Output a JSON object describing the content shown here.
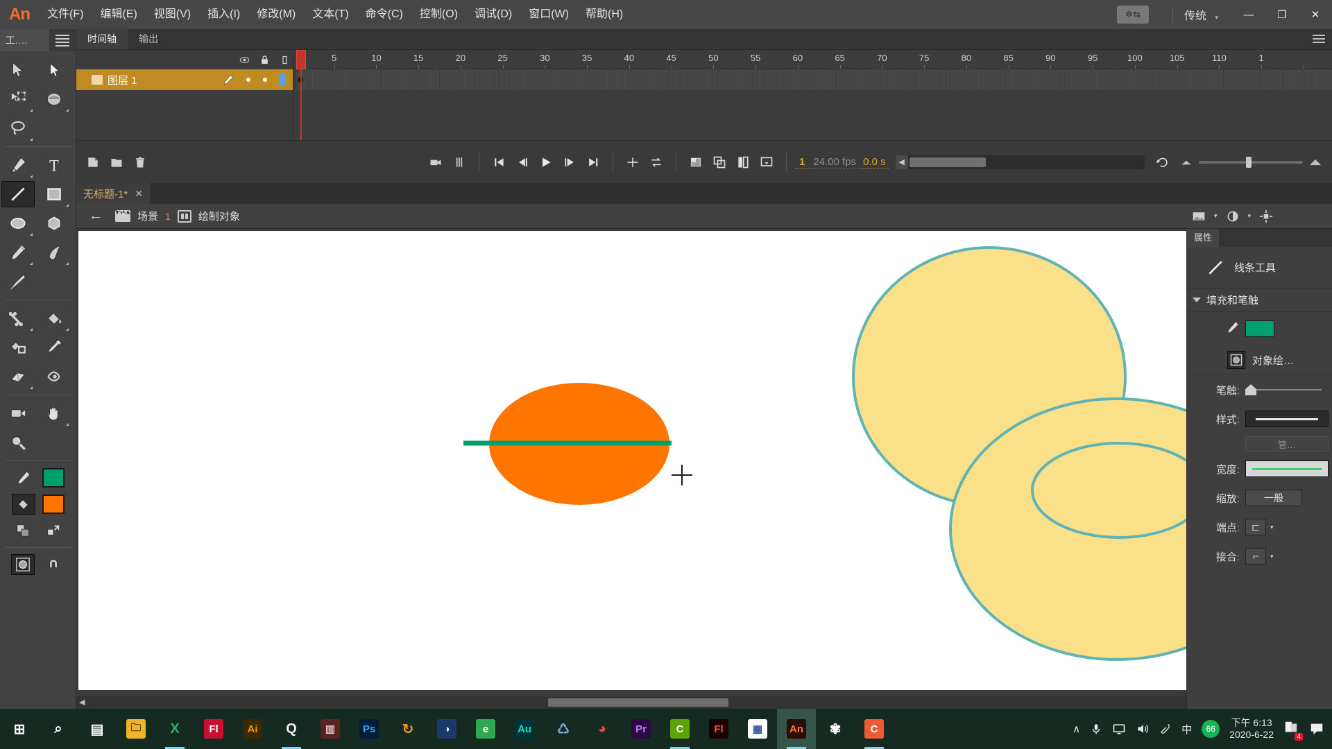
{
  "app": {
    "logo": "An",
    "workspace": "传统"
  },
  "menu": {
    "items": [
      "文件(F)",
      "编辑(E)",
      "视图(V)",
      "插入(I)",
      "修改(M)",
      "文本(T)",
      "命令(C)",
      "控制(O)",
      "调试(D)",
      "窗口(W)",
      "帮助(H)"
    ],
    "window_buttons": {
      "minimize": "—",
      "maximize": "❐",
      "close": "✕"
    },
    "sync_icon": "gear-sync-icon",
    "caret": "▾"
  },
  "toolbar": {
    "title": "工.…",
    "tools": [
      {
        "name": "selection-tool",
        "sel": false
      },
      {
        "name": "subselection-tool",
        "sel": false
      },
      {
        "name": "free-transform-tool",
        "sel": false
      },
      {
        "name": "gradient-transform-tool",
        "sel": false
      },
      {
        "name": "lasso-tool",
        "sel": false
      },
      {
        "name": "pen-tool",
        "sel": false
      },
      {
        "name": "text-tool",
        "sel": false
      },
      {
        "name": "line-tool",
        "sel": true
      },
      {
        "name": "rectangle-tool",
        "sel": false
      },
      {
        "name": "oval-tool",
        "sel": false
      },
      {
        "name": "polystar-tool",
        "sel": false
      },
      {
        "name": "pencil-tool",
        "sel": false
      },
      {
        "name": "brush-tool",
        "sel": false
      },
      {
        "name": "paint-brush-tool",
        "sel": false
      },
      {
        "name": "bone-tool",
        "sel": false
      },
      {
        "name": "paint-bucket-tool",
        "sel": false
      },
      {
        "name": "ink-bottle-tool",
        "sel": false
      },
      {
        "name": "eyedropper-tool",
        "sel": false
      },
      {
        "name": "eraser-tool",
        "sel": false
      },
      {
        "name": "width-tool",
        "sel": false
      },
      {
        "name": "camera-tool",
        "sel": false
      },
      {
        "name": "hand-tool",
        "sel": false
      },
      {
        "name": "zoom-tool",
        "sel": false
      }
    ],
    "stroke_color": "#00A06E",
    "fill_color": "#FF7500",
    "object_drawing_on": true
  },
  "timeline": {
    "tabs": [
      {
        "label": "时间轴",
        "active": true
      },
      {
        "label": "输出",
        "active": false
      }
    ],
    "ruler_labels": [
      "1",
      "5",
      "10",
      "15",
      "20",
      "25",
      "30",
      "35",
      "40",
      "45",
      "50",
      "55",
      "60",
      "65",
      "70",
      "75",
      "80",
      "85",
      "90",
      "95",
      "100",
      "105",
      "110",
      "1"
    ],
    "layers": [
      {
        "name": "图层 1",
        "selected": true
      }
    ],
    "header_icons": [
      "eye-icon",
      "lock-icon",
      "outline-icon"
    ],
    "footer": {
      "new_layer": "new-layer-icon",
      "new_folder": "new-folder-icon",
      "delete": "trash-icon",
      "camera": "camera-icon",
      "onion": "onion-skin-icon",
      "go_start": "go-to-start-icon",
      "step_back": "step-back-icon",
      "play": "play-icon",
      "step_fwd": "step-forward-icon",
      "go_end": "go-to-end-icon",
      "center": "center-frame-icon",
      "loop": "loop-icon",
      "onion1": "onion-skin-outline-icon",
      "onion2": "edit-multiple-frames-icon",
      "onion3": "modify-markers-icon",
      "onion4": "marker-menu-icon",
      "current_frame": "1",
      "fps": "24.00 fps",
      "elapsed": "0.0 s"
    },
    "playhead_frame": 1
  },
  "document": {
    "tab_title": "无标题-1*",
    "close_glyph": "✕"
  },
  "scene_bar": {
    "back": "←",
    "scene_label": "场景",
    "scene_number": "1",
    "object_label": "绘制对象"
  },
  "properties": {
    "tab": "属性",
    "tool_name": "线条工具",
    "section_title": "填充和笔触",
    "stroke_swatch": "#00A06E",
    "object_drawing_label": "对象绘…",
    "rows": [
      {
        "label": "笔触",
        "colon": ":",
        "type": "slider"
      },
      {
        "label": "样式",
        "colon": ":",
        "type": "style"
      },
      {
        "label": "",
        "colon": "",
        "type": "ghost",
        "value": "管…"
      },
      {
        "label": "宽度",
        "colon": ":",
        "type": "width"
      },
      {
        "label": "缩放",
        "colon": ":",
        "type": "select",
        "value": "一般"
      },
      {
        "label": "端点",
        "colon": ":",
        "type": "cap"
      },
      {
        "label": "接合",
        "colon": ":",
        "type": "join"
      }
    ]
  },
  "stage": {
    "shapes": [
      {
        "name": "orange-ellipse",
        "fill": "#FF7500",
        "stroke": "none"
      },
      {
        "name": "green-line",
        "stroke": "#00A06E"
      },
      {
        "name": "yellow-circle-top",
        "fill": "#FBE08A",
        "stroke": "#5FB3B3"
      },
      {
        "name": "yellow-ellipse-bottom",
        "fill": "#FBE08A",
        "stroke": "#5FB3B3"
      },
      {
        "name": "inner-ellipse-ring",
        "fill": "none",
        "stroke": "#5FB3B3"
      }
    ],
    "cursor": "crosshair-cursor"
  },
  "taskbar": {
    "items": [
      {
        "name": "start-button",
        "glyph": "⊞",
        "bg": "transparent",
        "fg": "#ffffff"
      },
      {
        "name": "search-icon",
        "glyph": "⌕",
        "bg": "transparent",
        "fg": "#ffffff"
      },
      {
        "name": "task-view-icon",
        "glyph": "▤",
        "bg": "transparent",
        "fg": "#ffffff"
      },
      {
        "name": "file-explorer-icon",
        "glyph": "🗀",
        "bg": "#f0b429",
        "fg": "#4a3400",
        "running": false
      },
      {
        "name": "wps-icon",
        "glyph": "X",
        "bg": "transparent",
        "fg": "#2fae6f",
        "running": true
      },
      {
        "name": "flash-icon",
        "glyph": "Fl",
        "bg": "#c9102f",
        "fg": "#ffffff",
        "running": false
      },
      {
        "name": "illustrator-icon",
        "glyph": "Ai",
        "bg": "#3a2a00",
        "fg": "#ff9a00",
        "running": false
      },
      {
        "name": "qq-icon",
        "glyph": "Q",
        "bg": "transparent",
        "fg": "#eeeeee",
        "running": true
      },
      {
        "name": "media-icon",
        "glyph": "▥",
        "bg": "#5b2222",
        "fg": "#e0c0c0",
        "running": false
      },
      {
        "name": "photoshop-icon",
        "glyph": "Ps",
        "bg": "#001e36",
        "fg": "#31a8ff",
        "running": false
      },
      {
        "name": "thunder-icon",
        "glyph": "↻",
        "bg": "transparent",
        "fg": "#f59b1c",
        "running": false
      },
      {
        "name": "player-icon",
        "glyph": "◑",
        "bg": "#1b3a6b",
        "fg": "#d7e6ff",
        "running": false
      },
      {
        "name": "browser-icon",
        "glyph": "e",
        "bg": "#2fa84f",
        "fg": "#ffffff",
        "running": false
      },
      {
        "name": "audition-icon",
        "glyph": "Au",
        "bg": "#00333a",
        "fg": "#00e4bb",
        "running": false
      },
      {
        "name": "recycle-icon",
        "glyph": "♺",
        "bg": "transparent",
        "fg": "#7fb3e0",
        "running": false
      },
      {
        "name": "netease-icon",
        "glyph": "◕",
        "bg": "transparent",
        "fg": "#e14b3c",
        "running": false
      },
      {
        "name": "premiere-icon",
        "glyph": "Pr",
        "bg": "#2a0a40",
        "fg": "#c77dff",
        "running": false
      },
      {
        "name": "camtasia-icon",
        "glyph": "C",
        "bg": "#5ea309",
        "fg": "#ffffff",
        "running": true
      },
      {
        "name": "flash2-icon",
        "glyph": "Fl",
        "bg": "#1a0000",
        "fg": "#ff4d4d",
        "running": false
      },
      {
        "name": "office-icon",
        "glyph": "▦",
        "bg": "#ffffff",
        "fg": "#2b579a",
        "running": false
      },
      {
        "name": "animate-icon",
        "glyph": "An",
        "bg": "#2a0d06",
        "fg": "#ff7a3d",
        "running": true,
        "active": true
      },
      {
        "name": "settings-icon",
        "glyph": "✾",
        "bg": "transparent",
        "fg": "#ffffff",
        "running": false
      },
      {
        "name": "camtasia2-icon",
        "glyph": "C",
        "bg": "#ef5a34",
        "fg": "#ffffff",
        "running": true
      }
    ],
    "tray": {
      "chevron": "∧",
      "mic": "mic-icon",
      "display": "display-icon",
      "volume": "volume-icon",
      "pen": "pen-icon",
      "ime": "中",
      "score": "66",
      "time": "下午 6:13",
      "date": "2020-6-22",
      "notes_badge": "4",
      "action_center": "action-center-icon"
    }
  }
}
